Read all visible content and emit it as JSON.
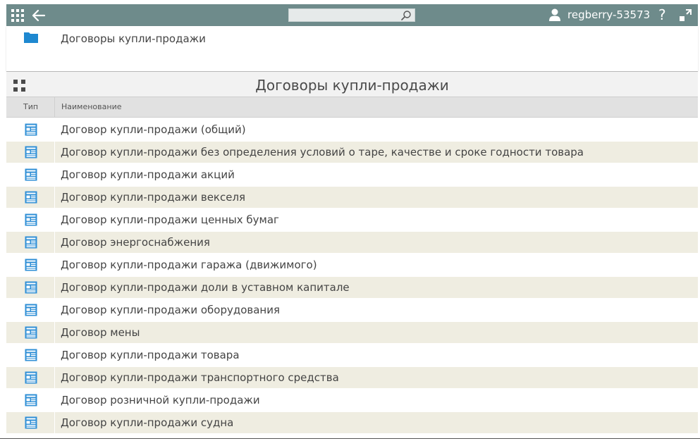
{
  "topbar": {
    "search_placeholder": "",
    "user_name": "regberry-53573",
    "help_label": "?"
  },
  "breadcrumb": {
    "label": "Договоры купли-продажи"
  },
  "header": {
    "title": "Договоры купли-продажи"
  },
  "columns": {
    "type": "Тип",
    "name": "Наименование"
  },
  "rows": [
    {
      "name": "Договор купли-продажи (общий)"
    },
    {
      "name": "Договор купли-продажи без определения условий о таре, качестве и сроке годности товара"
    },
    {
      "name": "Договор купли-продажи акций"
    },
    {
      "name": "Договор купли-продажи векселя"
    },
    {
      "name": "Договор купли-продажи ценных бумаг"
    },
    {
      "name": "Договор энергоснабжения"
    },
    {
      "name": "Договор купли-продажи гаража (движимого)"
    },
    {
      "name": "Договор купли-продажи доли в уставном капитале"
    },
    {
      "name": "Договор купли-продажи оборудования"
    },
    {
      "name": "Договор мены"
    },
    {
      "name": "Договор купли-продажи товара"
    },
    {
      "name": "Договор купли-продажи транспортного средства"
    },
    {
      "name": "Договор розничной купли-продажи"
    },
    {
      "name": "Договор купли-продажи судна"
    }
  ],
  "colors": {
    "topbar": "#6e8b8b",
    "row_alt": "#efede1",
    "doc_icon": "#2f8fd6",
    "folder_icon": "#1e88d0"
  },
  "icons": {
    "apps": "apps-grid-icon",
    "back": "arrow-left-icon",
    "search": "search-icon",
    "user": "user-icon",
    "fullscreen": "fullscreen-icon",
    "folder": "folder-icon",
    "document": "document-form-icon",
    "view_toggle": "tiles-view-icon"
  }
}
